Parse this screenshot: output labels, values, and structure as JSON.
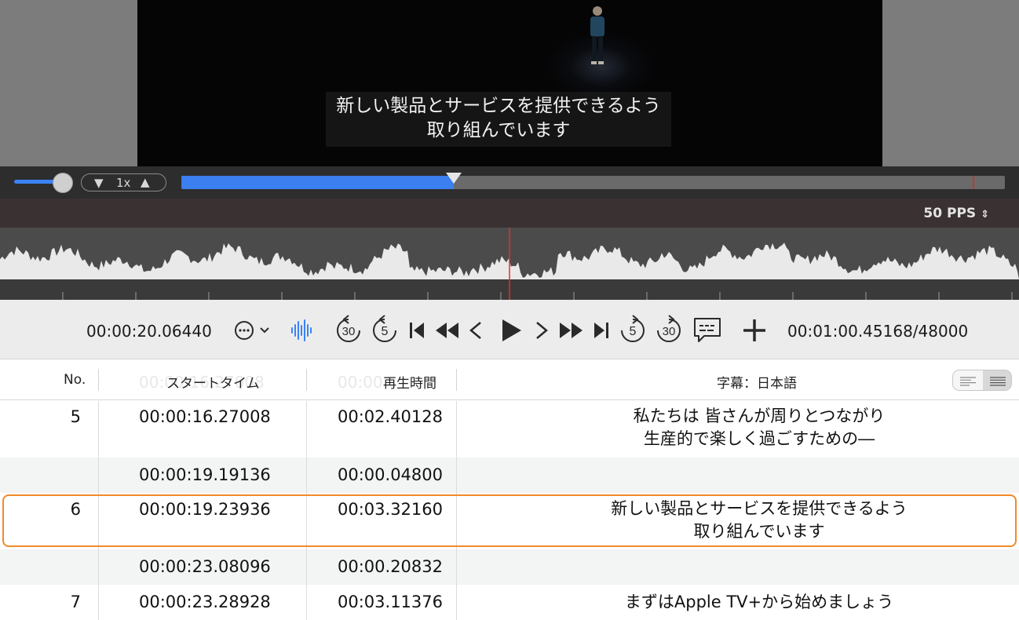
{
  "video": {
    "subtitle_line1": "新しい製品とサービスを提供できるよう",
    "subtitle_line2": "取り組んでいます"
  },
  "playback": {
    "speed_label": "1x",
    "volume_level": 1.0,
    "progress_fraction": 0.331,
    "speed_down_icon": "triangle-down-icon",
    "speed_up_icon": "triangle-up-icon"
  },
  "waveform": {
    "pps_label": "50 PPS"
  },
  "toolbar": {
    "current_time": "00:00:20.06440",
    "total_time": "00:01:00.45168/48000",
    "accent_color": "#3b82f6"
  },
  "table": {
    "headers": {
      "no": "No.",
      "start": "スタートタイム",
      "duration": "再生時間",
      "subtitle": "字幕：日本語"
    },
    "rows": [
      {
        "no": "5",
        "start": "00:00:16.27008",
        "duration": "00:02.40128",
        "line1": "私たちは 皆さんが周りとつながり",
        "line2": "生産的で楽しく過ごすための―"
      },
      {
        "no": "",
        "start": "00:00:19.19136",
        "duration": "00:00.04800",
        "line1": "",
        "line2": ""
      },
      {
        "no": "6",
        "start": "00:00:19.23936",
        "duration": "00:03.32160",
        "line1": "新しい製品とサービスを提供できるよう",
        "line2": "取り組んでいます"
      },
      {
        "no": "",
        "start": "00:00:23.08096",
        "duration": "00:00.20832",
        "line1": "",
        "line2": ""
      },
      {
        "no": "7",
        "start": "00:00:23.28928",
        "duration": "00:03.11376",
        "line1": "まずはApple TV+から始めましょう",
        "line2": ""
      }
    ],
    "selected_row_color": "#ef8a2a"
  }
}
